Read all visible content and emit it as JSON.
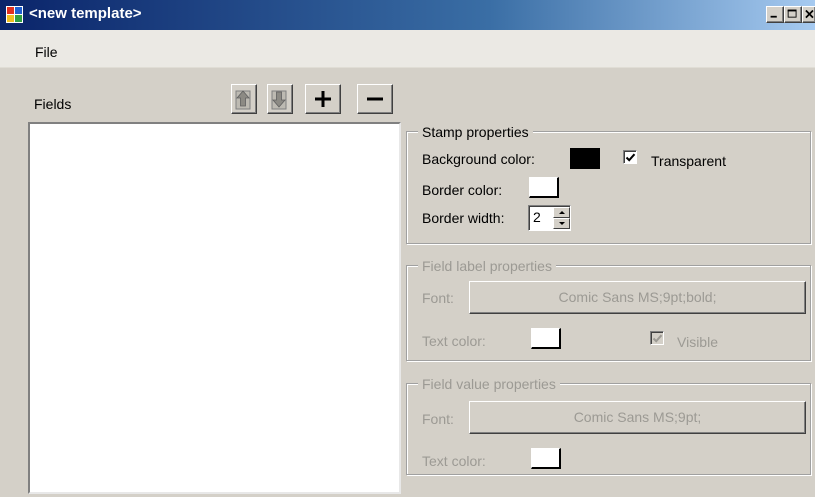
{
  "window": {
    "title": "<new template>",
    "colors": {
      "titlebar_start": "#0a246a",
      "titlebar_end": "#a6caf0",
      "face": "#d4d0c8"
    }
  },
  "menu": {
    "items": [
      {
        "label": "File"
      }
    ]
  },
  "fields_panel": {
    "label": "Fields",
    "toolbar": [
      {
        "icon": "move-up-icon"
      },
      {
        "icon": "move-down-icon"
      },
      {
        "icon": "plus-icon"
      },
      {
        "icon": "minus-icon"
      }
    ],
    "items": []
  },
  "stamp_properties": {
    "title": "Stamp properties",
    "background_color_label": "Background color:",
    "background_color": "#000000",
    "transparent_label": "Transparent",
    "transparent_checked": true,
    "border_color_label": "Border color:",
    "border_color": "#ffffff",
    "border_width_label": "Border width:",
    "border_width": "2"
  },
  "field_label_properties": {
    "title": "Field label properties",
    "enabled": false,
    "font_label": "Font:",
    "font_value": "Comic Sans MS;9pt;bold;",
    "text_color_label": "Text color:",
    "text_color": "#ffffff",
    "visible_label": "Visible",
    "visible_checked": true
  },
  "field_value_properties": {
    "title": "Field value properties",
    "enabled": false,
    "font_label": "Font:",
    "font_value": "Comic Sans MS;9pt;",
    "text_color_label": "Text color:",
    "text_color": "#ffffff"
  }
}
